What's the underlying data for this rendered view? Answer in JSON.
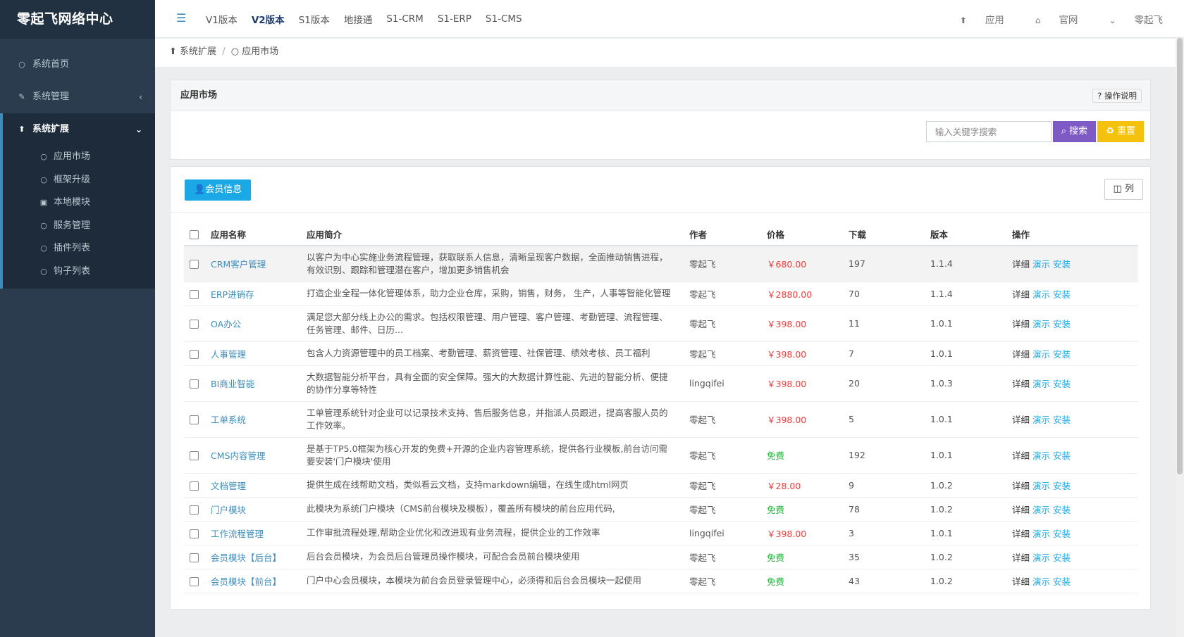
{
  "sidebar": {
    "logo": "零起飞网络中心",
    "items": [
      {
        "label": "系统首页",
        "icon": "circle-icon"
      },
      {
        "label": "系统管理",
        "icon": "wrench-icon",
        "caret": "‹"
      }
    ],
    "group": {
      "label": "系统扩展",
      "icon": "rocket-icon",
      "caret": "⌄",
      "subitems": [
        {
          "label": "应用市场",
          "icon": "circle-icon"
        },
        {
          "label": "框架升级",
          "icon": "circle-icon"
        },
        {
          "label": "本地模块",
          "icon": "lock-icon"
        },
        {
          "label": "服务管理",
          "icon": "circle-icon"
        },
        {
          "label": "插件列表",
          "icon": "circle-icon"
        },
        {
          "label": "钩子列表",
          "icon": "circle-icon"
        }
      ]
    }
  },
  "topbar": {
    "links": [
      "V1版本",
      "V2版本",
      "S1版本",
      "地接通",
      "S1-CRM",
      "S1-ERP",
      "S1-CMS"
    ],
    "active_link": "V2版本",
    "right": [
      {
        "label": "应用",
        "icon": "rocket-icon"
      },
      {
        "label": "官网",
        "icon": "home-icon"
      },
      {
        "label": "零起飞",
        "icon": "chevron-down-icon"
      }
    ]
  },
  "breadcrumb": {
    "items": [
      "系统扩展",
      "应用市场"
    ]
  },
  "search_panel": {
    "title": "应用市场",
    "help_label": "操作说明",
    "search_placeholder": "输入关键字搜索",
    "search_button": "搜索",
    "reset_button": "重置"
  },
  "list_panel": {
    "member_button": "会员信息",
    "columns_button": "列",
    "headers": [
      "应用名称",
      "应用简介",
      "作者",
      "价格",
      "下载",
      "版本",
      "操作"
    ],
    "rows": [
      {
        "name": "CRM客户管理",
        "desc": "以客户为中心实施业务流程管理，获取联系人信息，清晰呈现客户数据，全面推动销售进程，有效识别、跟踪和管理潜在客户，增加更多销售机会",
        "author": "零起飞",
        "price": "￥680.00",
        "free": false,
        "downloads": "197",
        "version": "1.1.4"
      },
      {
        "name": "ERP进销存",
        "desc": "打造企业全程一体化管理体系，助力企业仓库，采购，销售，财务， 生产，人事等智能化管理",
        "author": "零起飞",
        "price": "￥2880.00",
        "free": false,
        "downloads": "70",
        "version": "1.1.4"
      },
      {
        "name": "OA办公",
        "desc": "满足您大部分线上办公的需求。包括权限管理、用户管理、客户管理、考勤管理、流程管理、任务管理、邮件、日历...",
        "author": "零起飞",
        "price": "￥398.00",
        "free": false,
        "downloads": "11",
        "version": "1.0.1"
      },
      {
        "name": "人事管理",
        "desc": "包含人力资源管理中的员工档案、考勤管理、薪资管理、社保管理、绩效考核、员工福利",
        "author": "零起飞",
        "price": "￥398.00",
        "free": false,
        "downloads": "7",
        "version": "1.0.1"
      },
      {
        "name": "BI商业智能",
        "desc": "大数据智能分析平台，具有全面的安全保障。强大的大数据计算性能、先进的智能分析、便捷的协作分享等特性",
        "author": "lingqifei",
        "price": "￥398.00",
        "free": false,
        "downloads": "20",
        "version": "1.0.3"
      },
      {
        "name": "工单系统",
        "desc": "工单管理系统针对企业可以记录技术支持、售后服务信息，并指派人员跟进，提高客服人员的工作效率。",
        "author": "零起飞",
        "price": "￥398.00",
        "free": false,
        "downloads": "5",
        "version": "1.0.1"
      },
      {
        "name": "CMS内容管理",
        "desc": "是基于TP5.0框架为核心开发的免费+开源的企业内容管理系统，提供各行业模板,前台访问需要安装'门户模块'使用",
        "author": "零起飞",
        "price": "免费",
        "free": true,
        "downloads": "192",
        "version": "1.0.1"
      },
      {
        "name": "文档管理",
        "desc": "提供生成在线帮助文档，类似看云文档，支持markdown编辑，在线生成html网页",
        "author": "零起飞",
        "price": "￥28.00",
        "free": false,
        "downloads": "9",
        "version": "1.0.2"
      },
      {
        "name": "门户模块",
        "desc": "此模块为系统门户模块（CMS前台模块及模板），覆盖所有模块的前台应用代码,",
        "author": "零起飞",
        "price": "免费",
        "free": true,
        "downloads": "78",
        "version": "1.0.2"
      },
      {
        "name": "工作流程管理",
        "desc": "工作审批流程处理,帮助企业优化和改进现有业务流程，提供企业的工作效率",
        "author": "lingqifei",
        "price": "￥398.00",
        "free": false,
        "downloads": "3",
        "version": "1.0.1"
      },
      {
        "name": "会员模块【后台】",
        "desc": "后台会员模块，为会员后台管理员操作模块，可配合会员前台模块使用",
        "author": "零起飞",
        "price": "免费",
        "free": true,
        "downloads": "35",
        "version": "1.0.2"
      },
      {
        "name": "会员模块【前台】",
        "desc": "门户中心会员模块，本模块为前台会员登录管理中心，必须得和后台会员模块一起使用",
        "author": "零起飞",
        "price": "免费",
        "free": true,
        "downloads": "43",
        "version": "1.0.2"
      }
    ],
    "ops": [
      "详细",
      "演示",
      "安装"
    ]
  },
  "colors": {
    "accent": "#3c8dbc",
    "search": "#7e5ac4",
    "reset": "#f4c20d",
    "member": "#1aa9e6",
    "price": "#e84040",
    "free": "#22b53c"
  }
}
